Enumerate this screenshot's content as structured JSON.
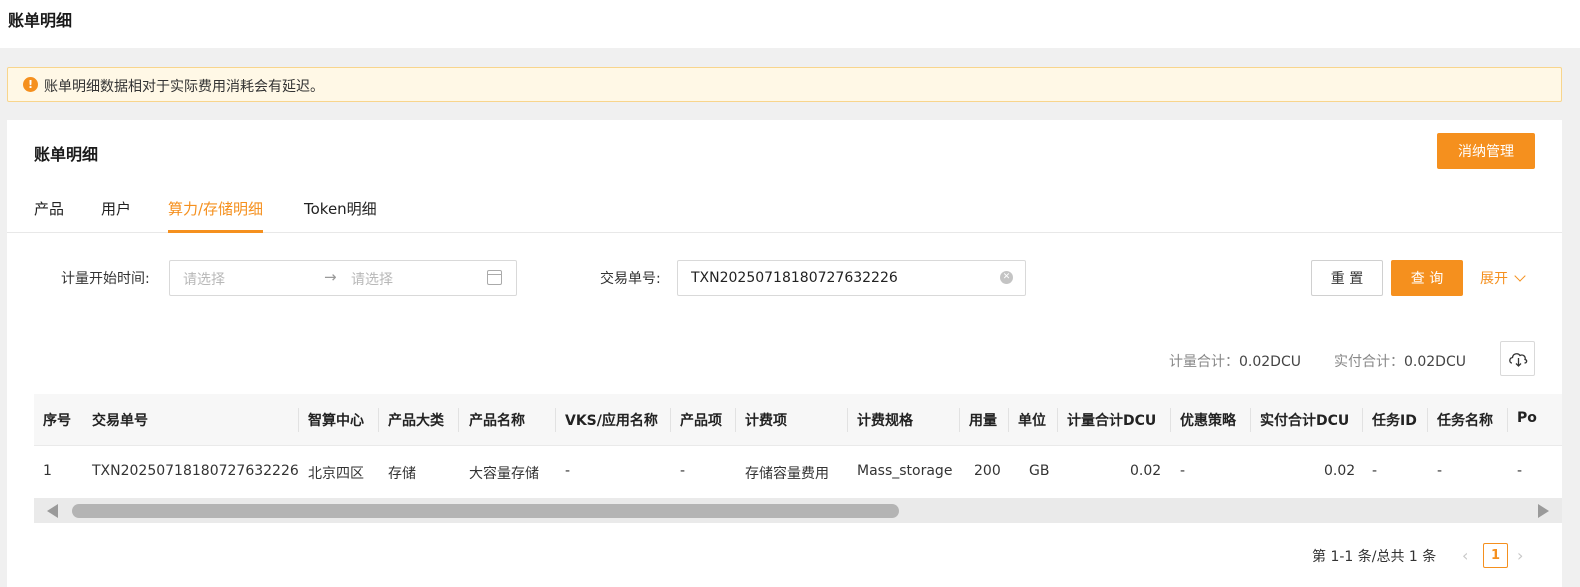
{
  "header": {
    "title": "账单明细"
  },
  "notice": {
    "text": "账单明细数据相对于实际费用消耗会有延迟。"
  },
  "card": {
    "title": "账单明细",
    "manage_button": "消纳管理",
    "tabs": [
      {
        "label": "产品",
        "active": false
      },
      {
        "label": "用户",
        "active": false
      },
      {
        "label": "算力/存储明细",
        "active": true
      },
      {
        "label": "Token明细",
        "active": false
      }
    ]
  },
  "filters": {
    "start_time_label": "计量开始时间",
    "start_placeholder": "请选择",
    "end_placeholder": "请选择",
    "txn_label": "交易单号",
    "txn_value": "TXN20250718180727632226",
    "reset_label": "重 置",
    "query_label": "查 询",
    "expand_label": "展开"
  },
  "summary": {
    "metered_label": "计量合计：",
    "metered_value": "0.02DCU",
    "paid_label": "实付合计：",
    "paid_value": "0.02DCU"
  },
  "table": {
    "columns": [
      "序号",
      "交易单号",
      "智算中心",
      "产品大类",
      "产品名称",
      "VKS/应用名称",
      "产品项",
      "计费项",
      "计费规格",
      "用量",
      "单位",
      "计量合计DCU",
      "优惠策略",
      "实付合计DCU",
      "任务ID",
      "任务名称",
      "Po"
    ],
    "rows": [
      [
        "1",
        "TXN20250718180727632226",
        "北京四区",
        "存储",
        "大容量存储",
        "-",
        "-",
        "存储容量费用",
        "Mass_storage",
        "200",
        "GB",
        "0.02",
        "-",
        "0.02",
        "-",
        "-",
        "-"
      ]
    ]
  },
  "pagination": {
    "total_text": "第 1-1 条/总共 1 条",
    "current_page": "1",
    "prev": "‹",
    "next": "›"
  },
  "colors": {
    "accent": "#f5901e",
    "notice_bg": "#fff8e6"
  }
}
